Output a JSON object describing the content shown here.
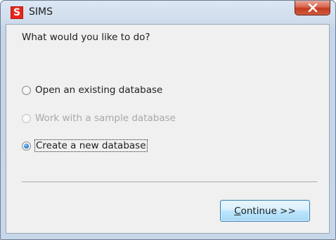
{
  "window": {
    "title": "SIMS",
    "icon_letter": "S",
    "icon_color": "#e8261b",
    "close_icon": "close-icon"
  },
  "dialog": {
    "question": "What would you like to do?",
    "options": [
      {
        "label": "Open an existing database",
        "selected": false,
        "enabled": true
      },
      {
        "label": "Work with a sample database",
        "selected": false,
        "enabled": false
      },
      {
        "label": "Create a new database",
        "selected": true,
        "enabled": true
      }
    ]
  },
  "buttons": {
    "continue_accel": "C",
    "continue_rest": "ontinue >>"
  }
}
